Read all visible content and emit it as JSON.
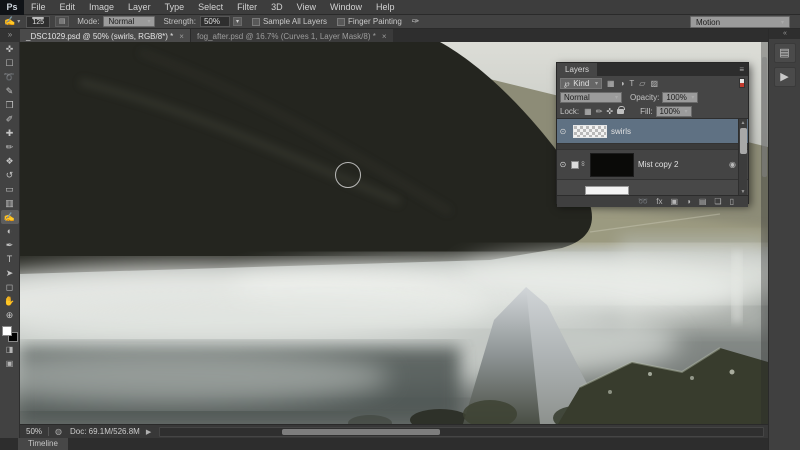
{
  "app": {
    "logo": "Ps",
    "selected_layer_color": "#5f7183",
    "chrome_color": "#3d3d3d"
  },
  "menu": {
    "items": [
      "File",
      "Edit",
      "Image",
      "Layer",
      "Type",
      "Select",
      "Filter",
      "3D",
      "View",
      "Window",
      "Help"
    ]
  },
  "options": {
    "tool_icon": "smudge-tool-icon",
    "tool_glyph": "✍",
    "brush_size": "125",
    "mode_label": "Mode:",
    "mode_value": "Normal",
    "strength_label": "Strength:",
    "strength_value": "50%",
    "sample_all_layers_label": "Sample All Layers",
    "finger_painting_label": "Finger Painting",
    "workspace_value": "Motion"
  },
  "tabs": [
    {
      "title": "_DSC1029.psd @ 50% (swirls, RGB/8*) *",
      "close": "×",
      "active": true
    },
    {
      "title": "fog_after.psd @ 16.7% (Curves 1, Layer Mask/8) *",
      "close": "×",
      "active": false
    }
  ],
  "tools": [
    {
      "name": "move-tool",
      "glyph": "✜"
    },
    {
      "name": "marquee-tool",
      "glyph": "☐"
    },
    {
      "name": "lasso-tool",
      "glyph": "➰"
    },
    {
      "name": "quick-selection-tool",
      "glyph": "✎"
    },
    {
      "name": "crop-tool",
      "glyph": "❒"
    },
    {
      "name": "eyedropper-tool",
      "glyph": "✐"
    },
    {
      "name": "healing-brush-tool",
      "glyph": "✚"
    },
    {
      "name": "brush-tool",
      "glyph": "✏"
    },
    {
      "name": "clone-stamp-tool",
      "glyph": "❖"
    },
    {
      "name": "history-brush-tool",
      "glyph": "↺"
    },
    {
      "name": "eraser-tool",
      "glyph": "▭"
    },
    {
      "name": "gradient-tool",
      "glyph": "▥"
    },
    {
      "name": "smudge-tool",
      "glyph": "✍",
      "active": true
    },
    {
      "name": "dodge-tool",
      "glyph": "◐"
    },
    {
      "name": "pen-tool",
      "glyph": "✒"
    },
    {
      "name": "type-tool",
      "glyph": "T"
    },
    {
      "name": "path-selection-tool",
      "glyph": "➤"
    },
    {
      "name": "shape-tool",
      "glyph": "◻"
    },
    {
      "name": "hand-tool",
      "glyph": "✋"
    },
    {
      "name": "zoom-tool",
      "glyph": "⊕"
    }
  ],
  "tool_extras": [
    {
      "name": "quick-mask-button",
      "glyph": "◨"
    },
    {
      "name": "screen-mode-button",
      "glyph": "▣"
    }
  ],
  "layers_panel": {
    "title": "Layers",
    "panel_menu_glyph": "≡",
    "kind_filter_glyph": "℘",
    "kind_value": "Kind",
    "filter_icons": [
      {
        "name": "filter-pixel-layers-icon",
        "glyph": "▦"
      },
      {
        "name": "filter-adjustment-layers-icon",
        "glyph": "◑"
      },
      {
        "name": "filter-type-layers-icon",
        "glyph": "T"
      },
      {
        "name": "filter-shape-layers-icon",
        "glyph": "▱"
      },
      {
        "name": "filter-smart-objects-icon",
        "glyph": "▨"
      }
    ],
    "blend_mode_value": "Normal",
    "opacity_label": "Opacity:",
    "opacity_value": "100%",
    "lock_label": "Lock:",
    "lock_icons": [
      {
        "name": "lock-transparency-icon",
        "glyph": "▦"
      },
      {
        "name": "lock-paint-icon",
        "glyph": "✏"
      },
      {
        "name": "lock-position-icon",
        "glyph": "✜"
      }
    ],
    "fill_label": "Fill:",
    "fill_value": "100%",
    "layers": [
      {
        "name": "swirls",
        "selected": true,
        "visible": true,
        "thumb": "checker"
      },
      {
        "name": "Mist copy 2",
        "selected": false,
        "visible": true,
        "thumb": "black",
        "badge": "◉"
      }
    ],
    "bottom_icons": [
      {
        "name": "link-layers-icon",
        "glyph": "➿"
      },
      {
        "name": "layer-style-icon",
        "glyph": "fx"
      },
      {
        "name": "add-mask-icon",
        "glyph": "▣"
      },
      {
        "name": "adjustment-layer-icon",
        "glyph": "◑"
      },
      {
        "name": "new-group-icon",
        "glyph": "▤"
      },
      {
        "name": "new-layer-icon",
        "glyph": "❏"
      },
      {
        "name": "delete-layer-icon",
        "glyph": "▯"
      }
    ]
  },
  "right_dock": {
    "collapse_glyph": "«",
    "icons": [
      {
        "name": "history-panel-icon",
        "glyph": "▤"
      },
      {
        "name": "actions-panel-icon",
        "glyph": "▶"
      }
    ]
  },
  "status": {
    "zoom_value": "50%",
    "doc_value": "Doc: 69.1M/526.8M",
    "flyout_glyph": "▶"
  },
  "timeline": {
    "tab_label": "Timeline"
  }
}
